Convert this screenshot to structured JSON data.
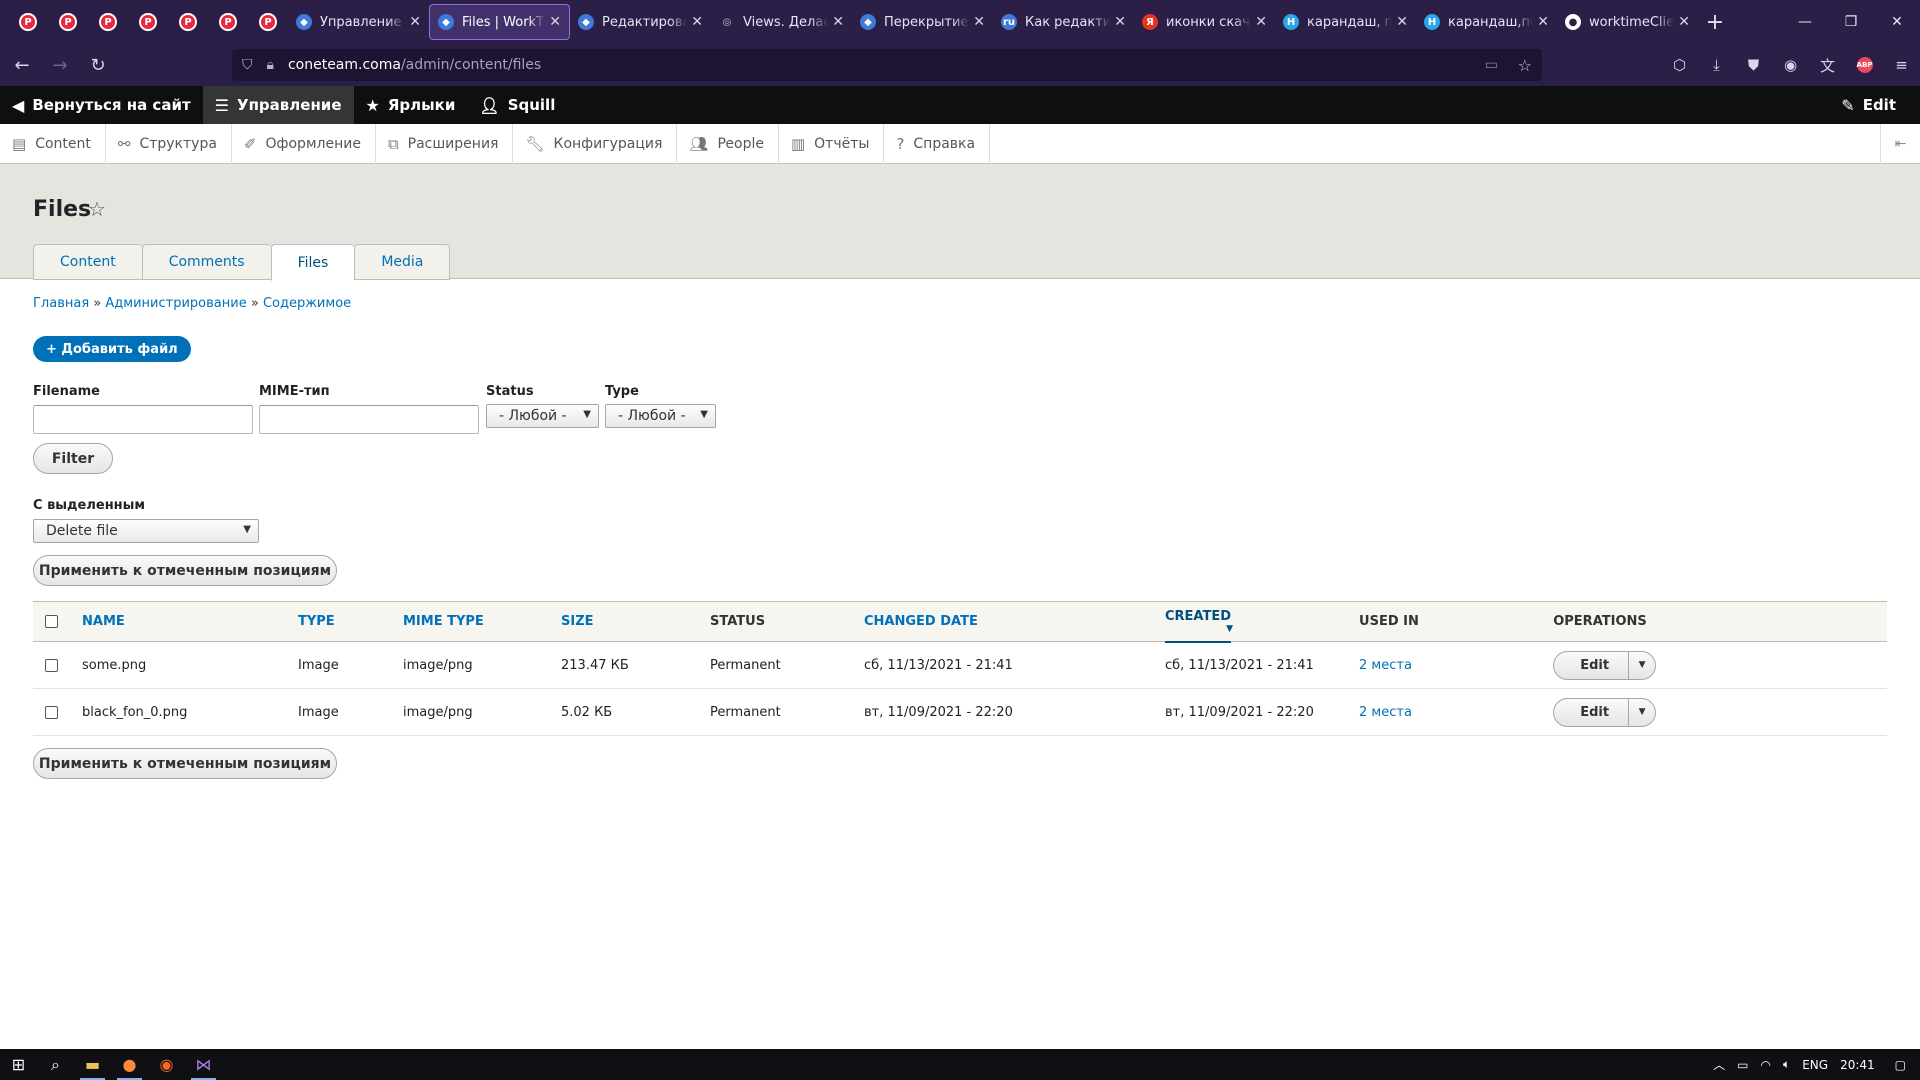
{
  "browser": {
    "pinned_tabs": 7,
    "tabs": [
      {
        "title": "Управление по",
        "favicon_color": "#3f7ad6",
        "active": false
      },
      {
        "title": "Files | WorkTime",
        "favicon_color": "#3f7ad6",
        "active": true
      },
      {
        "title": "Редактировани",
        "favicon_color": "#3f7ad6",
        "active": false
      },
      {
        "title": "Views. Делаем",
        "favicon_color": "#8a80a6",
        "active": false
      },
      {
        "title": "Перекрытие гл",
        "favicon_color": "#3f7ad6",
        "active": false
      },
      {
        "title": "Как редактиро",
        "favicon_color": "#3f7ad6",
        "active": false
      },
      {
        "title": "иконки скачать",
        "favicon_color": "#e5331d",
        "active": false
      },
      {
        "title": "карандаш, пол",
        "favicon_color": "#2aa5e8",
        "active": false
      },
      {
        "title": "карандаш,поле",
        "favicon_color": "#2aa5e8",
        "active": false
      },
      {
        "title": "worktimeClient",
        "favicon_color": "#ffffff",
        "active": false
      }
    ],
    "url_host": "coneteam.coma",
    "url_path": "/admin/content/files"
  },
  "toolbar": {
    "back_to_site": "Вернуться на сайт",
    "manage": "Управление",
    "shortcuts": "Ярлыки",
    "user": "Squill",
    "edit": "Edit"
  },
  "tray": {
    "items": [
      "Content",
      "Структура",
      "Оформление",
      "Расширения",
      "Конфигурация",
      "People",
      "Отчёты",
      "Справка"
    ]
  },
  "page": {
    "title": "Files",
    "tabs": [
      "Content",
      "Comments",
      "Files",
      "Media"
    ],
    "active_tab": "Files"
  },
  "breadcrumb": {
    "home": "Главная",
    "admin": "Администрирование",
    "content": "Содержимое",
    "sep": "»"
  },
  "add_file_button": "+ Добавить файл",
  "filters": {
    "filename_label": "Filename",
    "filename_value": "",
    "mime_label": "MIME-тип",
    "mime_value": "",
    "status_label": "Status",
    "status_value": "- Любой -",
    "type_label": "Type",
    "type_value": "- Любой -",
    "filter_button": "Filter"
  },
  "bulk": {
    "label": "С выделенным",
    "action_value": "Delete file",
    "apply_button": "Применить к отмеченным позициям"
  },
  "table": {
    "columns": [
      "NAME",
      "TYPE",
      "MIME TYPE",
      "SIZE",
      "STATUS",
      "CHANGED DATE",
      "CREATED",
      "USED IN",
      "OPERATIONS"
    ],
    "rows": [
      {
        "name": "some.png",
        "type": "Image",
        "mime": "image/png",
        "size": "213.47 КБ",
        "status": "Permanent",
        "changed": "сб, 11/13/2021 - 21:41",
        "created": "сб, 11/13/2021 - 21:41",
        "used_in": "2 места",
        "op": "Edit"
      },
      {
        "name": "black_fon_0.png",
        "type": "Image",
        "mime": "image/png",
        "size": "5.02 КБ",
        "status": "Permanent",
        "changed": "вт, 11/09/2021 - 22:20",
        "created": "вт, 11/09/2021 - 22:20",
        "used_in": "2 места",
        "op": "Edit"
      }
    ]
  },
  "taskbar": {
    "lang": "ENG",
    "time": "20:41"
  }
}
